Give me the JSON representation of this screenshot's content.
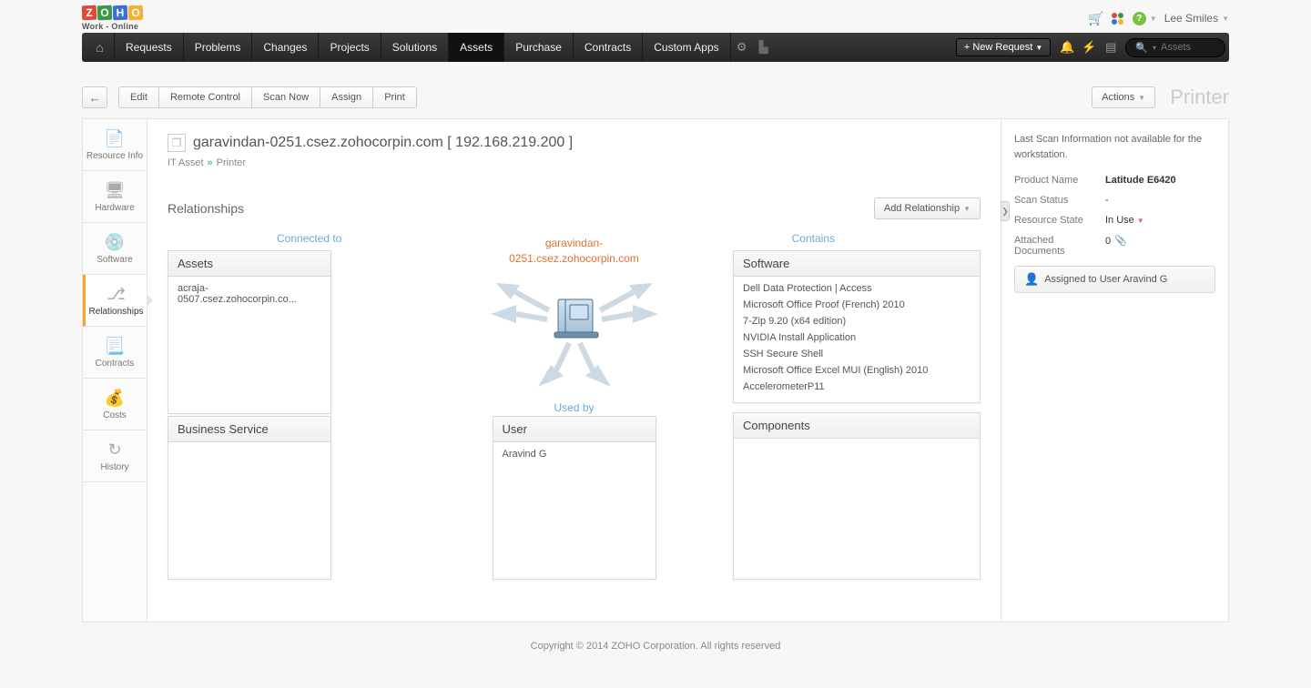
{
  "brand": {
    "letters": [
      "Z",
      "O",
      "H",
      "O"
    ],
    "colors": [
      "#d94b3b",
      "#3a9a42",
      "#3a6fd9",
      "#f2b134"
    ],
    "sub": "Work - Online"
  },
  "top_user": {
    "name": "Lee Smiles"
  },
  "nav": {
    "items": [
      "Requests",
      "Problems",
      "Changes",
      "Projects",
      "Solutions",
      "Assets",
      "Purchase",
      "Contracts",
      "Custom Apps"
    ],
    "active": 5,
    "new_request": "+ New Request",
    "search_placeholder": "Assets"
  },
  "toolbar": {
    "buttons": [
      "Edit",
      "Remote Control",
      "Scan Now",
      "Assign",
      "Print"
    ],
    "actions": "Actions",
    "page_type": "Printer"
  },
  "side_tabs": [
    {
      "label": "Resource Info",
      "icon": "📄"
    },
    {
      "label": "Hardware",
      "icon": "🖥"
    },
    {
      "label": "Software",
      "icon": "💿"
    },
    {
      "label": "Relationships",
      "icon": "⎇"
    },
    {
      "label": "Contracts",
      "icon": "📃"
    },
    {
      "label": "Costs",
      "icon": "💰"
    },
    {
      "label": "History",
      "icon": "↻"
    }
  ],
  "side_active": 3,
  "asset": {
    "title": "garavindan-0251.csez.zohocorpin.com [ 192.168.219.200 ]",
    "crumb1": "IT Asset",
    "crumb2": "Printer",
    "center_name": "garavindan-0251.csez.zohocorpin.com"
  },
  "rel": {
    "title": "Relationships",
    "add": "Add Relationship",
    "labels": {
      "connected": "Connected to",
      "contains": "Contains",
      "usedby": "Used by"
    }
  },
  "cards": {
    "assets": {
      "title": "Assets",
      "items": [
        "acraja-0507.csez.zohocorpin.co..."
      ]
    },
    "biz": {
      "title": "Business Service",
      "items": []
    },
    "user": {
      "title": "User",
      "items": [
        "Aravind G"
      ]
    },
    "sw": {
      "title": "Software",
      "items": [
        "Dell Data Protection | Access",
        "Microsoft Office Proof (French) 2010",
        "7-Zip 9.20 (x64 edition)",
        "NVIDIA Install Application",
        "SSH Secure Shell",
        "Microsoft Office Excel MUI (English) 2010",
        "AccelerometerP11"
      ]
    },
    "comp": {
      "title": "Components",
      "items": []
    }
  },
  "right": {
    "note": "Last Scan Information not available for the workstation.",
    "product_name_k": "Product Name",
    "product_name_v": "Latitude E6420",
    "scan_status_k": "Scan Status",
    "scan_status_v": "-",
    "resource_state_k": "Resource State",
    "resource_state_v": "In Use",
    "attached_k": "Attached Documents",
    "attached_v": "0",
    "assigned": "Assigned to User Aravind G"
  },
  "footer": "Copyright © 2014 ZOHO Corporation. All rights reserved"
}
